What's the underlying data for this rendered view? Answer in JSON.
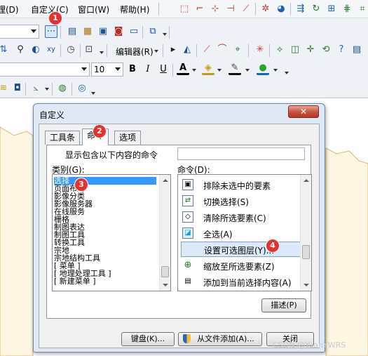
{
  "menubar": {
    "items": [
      {
        "label": "理(D)"
      },
      {
        "label": "自定义(C)"
      },
      {
        "label": "窗口(W)"
      },
      {
        "label": "帮助(H)"
      }
    ]
  },
  "toolbar": {
    "editor_label": "编辑器(R)",
    "font_size": "10",
    "bold": "B",
    "italic": "I",
    "underline": "U",
    "font_color_letter": "A",
    "partial_label": "ㅊ"
  },
  "dialog": {
    "title": "自定义",
    "close_symbol": "✕",
    "tabs": [
      {
        "label": "工具条"
      },
      {
        "label": "命令"
      },
      {
        "label": "选项"
      }
    ],
    "active_tab": "命令",
    "show_commands_label": "显示包含以下内容的命令",
    "search_value": "",
    "categories_label": "类别(G):",
    "commands_label": "命令(D):",
    "categories": [
      {
        "label": "选择",
        "selected": true
      },
      {
        "label": "页面布局"
      },
      {
        "label": "影像分类"
      },
      {
        "label": "影像服务器"
      },
      {
        "label": "在线服务"
      },
      {
        "label": "栅格"
      },
      {
        "label": "制图表达"
      },
      {
        "label": "制图工具"
      },
      {
        "label": "转换工具"
      },
      {
        "label": "宗地"
      },
      {
        "label": "宗地结构工具"
      },
      {
        "label": "[ 菜单 ]"
      },
      {
        "label": "[ 地理处理工具 ]"
      },
      {
        "label": "[ 新建菜单 ]"
      }
    ],
    "commands": [
      {
        "label": "排除未选中的要素",
        "icon": "exclude-unselected-icon",
        "glyph": "▣"
      },
      {
        "label": "切换选择(S)",
        "icon": "switch-selection-icon",
        "glyph": "⇄"
      },
      {
        "label": "清除所选要素(C)",
        "icon": "clear-selection-icon",
        "glyph": "◇"
      },
      {
        "label": "全选(A)",
        "icon": "select-all-icon",
        "glyph": "◪"
      },
      {
        "label": "设置可选图层(Y)...",
        "icon": "set-selectable-layers-icon",
        "glyph": "",
        "selected": true
      },
      {
        "label": "缩放至所选要素(Z)",
        "icon": "zoom-to-selected-icon",
        "glyph": "⊕"
      },
      {
        "label": "添加到当前选择内容(A)",
        "icon": "add-to-selection-icon",
        "glyph": "▤"
      }
    ],
    "describe_button": "描述(P)",
    "keyboard_button": "键盘(K)...",
    "add_from_file_button": "从文件添加(A)...",
    "close_button": "关闭"
  },
  "badges": [
    "1",
    "2",
    "3",
    "4"
  ],
  "watermark": "CSDN @YuanYWRS",
  "colors": {
    "accent_selection": "#3399ff",
    "badge_red": "#e5322d",
    "map_fill": "#fdf6e3",
    "map_border": "#d9b96a"
  }
}
